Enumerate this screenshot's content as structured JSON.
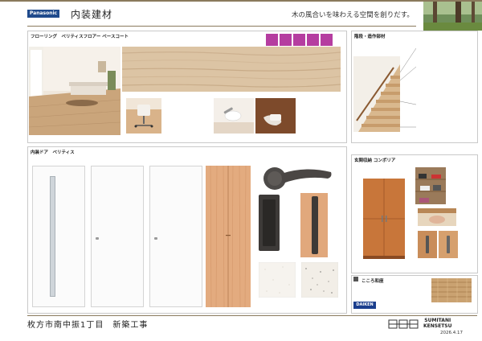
{
  "header": {
    "logo": "Panasonic",
    "title": "内装建材",
    "tagline": "木の風合いを味わえる空間を創りだす。"
  },
  "flooring": {
    "title": "フローリング　ベリティスフロアー ベースコート",
    "badges": [
      "",
      "",
      "",
      "",
      ""
    ]
  },
  "stairs": {
    "title": "階段・造作部材"
  },
  "doors": {
    "title": "内装ドア　ベリティス",
    "labels": [
      "",
      "",
      "",
      ""
    ],
    "hardware": [
      "",
      "",
      "",
      ""
    ]
  },
  "storage": {
    "title": "玄関収納 コンポリア"
  },
  "tatami": {
    "title": "こころ和座"
  },
  "footer": {
    "project": "枚方市南中振1丁目　新築工事",
    "brand_line1": "SUMITANI",
    "brand_line2": "KENSETSU",
    "daiken": "DAIKEN",
    "date": "2026.4.17"
  },
  "colors": {
    "accent": "#8a7a5c",
    "badge": "#b53da0",
    "logo": "#1f4a8c",
    "daiken": "#1b3e8d"
  }
}
